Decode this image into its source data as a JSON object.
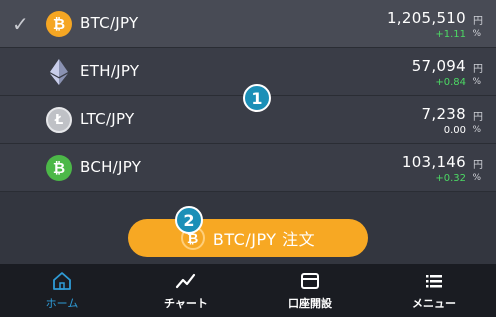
{
  "rows": [
    {
      "pair": "BTC/JPY",
      "price": "1,205,510",
      "unit": "円",
      "change": "+1.11",
      "pct": "%",
      "icon": "bitcoin-icon",
      "selected": true
    },
    {
      "pair": "ETH/JPY",
      "price": "57,094",
      "unit": "円",
      "change": "+0.84",
      "pct": "%",
      "icon": "ethereum-icon"
    },
    {
      "pair": "LTC/JPY",
      "price": "7,238",
      "unit": "円",
      "change": "0.00",
      "pct": "%",
      "icon": "litecoin-icon"
    },
    {
      "pair": "BCH/JPY",
      "price": "103,146",
      "unit": "円",
      "change": "+0.32",
      "pct": "%",
      "icon": "bitcoin-cash-icon"
    }
  ],
  "badges": {
    "one": "1",
    "two": "2"
  },
  "order_button": {
    "label": "BTC/JPY 注文"
  },
  "tabs": [
    {
      "label": "ホーム",
      "icon": "home-icon",
      "active": true
    },
    {
      "label": "チャート",
      "icon": "chart-icon"
    },
    {
      "label": "口座開設",
      "icon": "account-card-icon"
    },
    {
      "label": "メニュー",
      "icon": "menu-icon"
    }
  ],
  "colors": {
    "accent_orange": "#f7a823",
    "positive_green": "#4cd964",
    "active_tab": "#2f9bd6",
    "badge_blue": "#1b8fb7"
  }
}
